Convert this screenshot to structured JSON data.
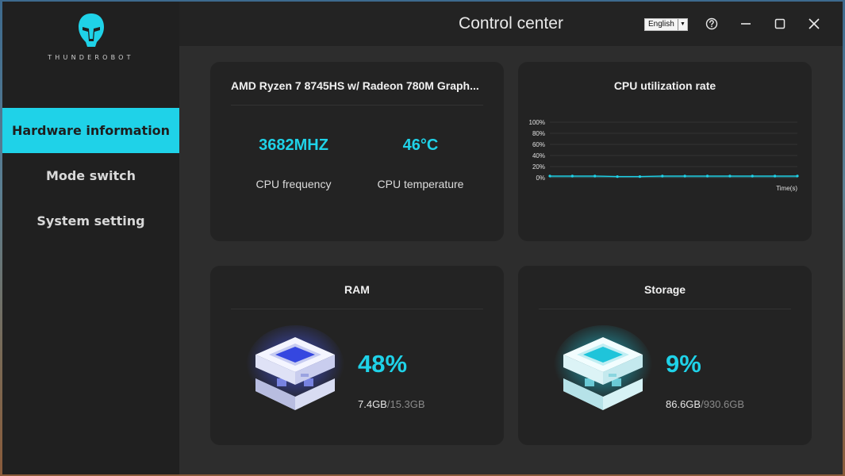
{
  "sidebar": {
    "brand": "THUNDEROBOT",
    "items": [
      {
        "label": "Hardware information",
        "active": true
      },
      {
        "label": "Mode switch",
        "active": false
      },
      {
        "label": "System setting",
        "active": false
      }
    ]
  },
  "header": {
    "title": "Control center",
    "language": "English"
  },
  "cpu": {
    "name": "AMD Ryzen 7 8745HS w/ Radeon 780M Graph...",
    "frequency_value": "3682MHZ",
    "frequency_label": "CPU frequency",
    "temperature_value": "46°C",
    "temperature_label": "CPU temperature"
  },
  "chart_data": {
    "type": "line",
    "title": "CPU utilization rate",
    "xlabel": "Time(s)",
    "ylabel": "",
    "ylim": [
      0,
      100
    ],
    "yticks": [
      "100%",
      "80%",
      "60%",
      "40%",
      "20%",
      "0%"
    ],
    "values": [
      3,
      3,
      3,
      2,
      2,
      3,
      3,
      3,
      3,
      3,
      3,
      3
    ],
    "color": "#1fd2e8",
    "grid": true
  },
  "ram": {
    "title": "RAM",
    "percent": "48%",
    "used": "7.4GB",
    "total": "/15.3GB"
  },
  "storage": {
    "title": "Storage",
    "percent": "9%",
    "used": "86.6GB",
    "total": "/930.6GB"
  },
  "colors": {
    "accent": "#1fd2e8",
    "ram_icon": "#3b4fe0",
    "storage_icon": "#1fd2e8"
  }
}
